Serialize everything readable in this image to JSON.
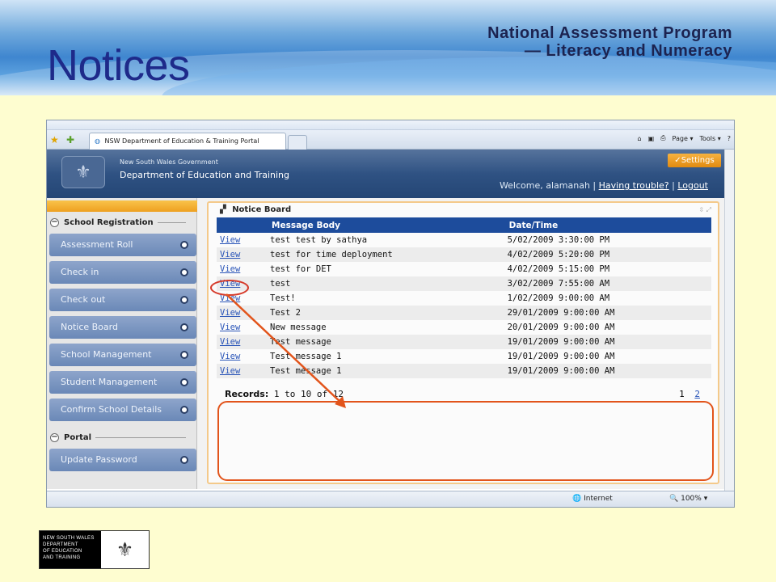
{
  "slide": {
    "title": "Notices",
    "program_line1": "National Assessment Program",
    "program_line2": "— Literacy and Numeracy"
  },
  "browser": {
    "tab_title": "NSW Department of Education & Training Portal",
    "cmd_page": "Page ▾",
    "cmd_tools": "Tools ▾",
    "status_zone": "Internet",
    "zoom": "100%"
  },
  "portal": {
    "government": "New South Wales Government",
    "department": "Department of Education and Training",
    "settings_label": "Settings",
    "welcome_prefix": "Welcome, alamanah |",
    "having_trouble": "Having trouble?",
    "separator": "|",
    "logout": "Logout"
  },
  "sidebar": {
    "section1": "School Registration",
    "items": [
      {
        "label": "Assessment Roll"
      },
      {
        "label": "Check in"
      },
      {
        "label": "Check out"
      },
      {
        "label": "Notice Board"
      },
      {
        "label": "School Management"
      },
      {
        "label": "Student Management"
      },
      {
        "label": "Confirm School Details"
      }
    ],
    "section2": "Portal",
    "portal_items": [
      {
        "label": "Update Password"
      }
    ]
  },
  "notice_board": {
    "title": "Notice Board",
    "col_body": "Message Body",
    "col_date": "Date/Time",
    "view_label": "View",
    "rows": [
      {
        "body": "test test by sathya",
        "date": "5/02/2009 3:30:00 PM"
      },
      {
        "body": "test for time deployment",
        "date": "4/02/2009 5:20:00 PM"
      },
      {
        "body": "test for DET",
        "date": "4/02/2009 5:15:00 PM"
      },
      {
        "body": "test",
        "date": "3/02/2009 7:55:00 AM"
      },
      {
        "body": "Test!",
        "date": "1/02/2009 9:00:00 AM"
      },
      {
        "body": "Test 2",
        "date": "29/01/2009 9:00:00 AM"
      },
      {
        "body": "New message",
        "date": "20/01/2009 9:00:00 AM"
      },
      {
        "body": "Test message",
        "date": "19/01/2009 9:00:00 AM"
      },
      {
        "body": "Test message 1",
        "date": "19/01/2009 9:00:00 AM"
      },
      {
        "body": "Test message 1",
        "date": "19/01/2009 9:00:00 AM"
      }
    ],
    "records_label": "Records:",
    "records_text": "1 to 10 of 12",
    "page1": "1",
    "page2": "2"
  },
  "footer": {
    "logo_line1": "NEW SOUTH WALES",
    "logo_line2": "DEPARTMENT",
    "logo_line3": "OF EDUCATION",
    "logo_line4": "AND TRAINING"
  },
  "colors": {
    "slide_bg": "#fefdd0",
    "title": "#1e2a8a",
    "nav_item": "#7a93bf",
    "table_header": "#1d4c9c",
    "annotation": "#e2541b"
  }
}
